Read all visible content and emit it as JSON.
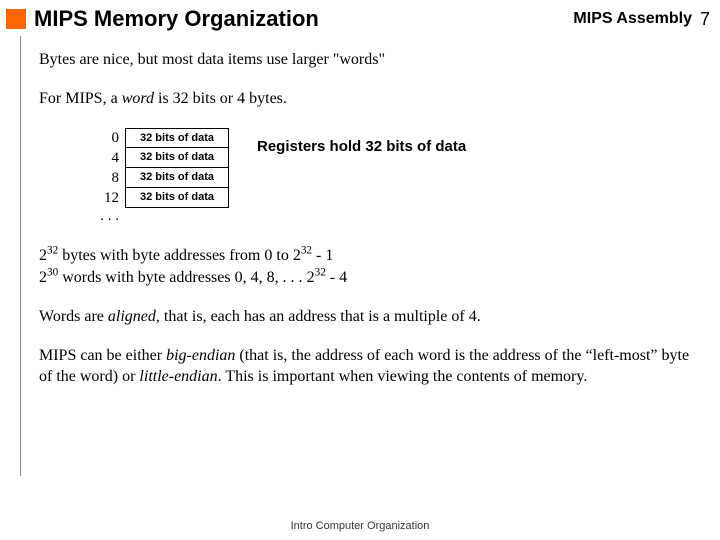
{
  "header": {
    "title": "MIPS Memory Organization",
    "topic": "MIPS Assembly",
    "page_number": "7"
  },
  "body": {
    "line1": "Bytes are nice, but most data items use larger \"words\"",
    "line2_pre": "For MIPS, a ",
    "line2_word": "word",
    "line2_post": " is 32 bits or 4 bytes."
  },
  "memory": {
    "rows": [
      {
        "addr": "0",
        "label": "32 bits of data"
      },
      {
        "addr": "4",
        "label": "32 bits of data"
      },
      {
        "addr": "8",
        "label": "32 bits of data"
      },
      {
        "addr": "12",
        "label": "32 bits of data"
      }
    ],
    "ellipsis": ". . .",
    "register_note": "Registers hold 32 bits of data"
  },
  "addr_space": {
    "l1a": "2",
    "l1b": "32",
    "l1c": " bytes with byte addresses from 0 to 2",
    "l1d": "32",
    "l1e": " - 1",
    "l2a": "2",
    "l2b": "30",
    "l2c": " words with byte addresses 0, 4, 8, . . . 2",
    "l2d": "32",
    "l2e": " - 4"
  },
  "aligned": {
    "pre": "Words are ",
    "word": "aligned",
    "post": ", that is, each has an address that is a multiple of 4."
  },
  "endian": {
    "a": "MIPS can be either ",
    "b": "big-endian",
    "c": " (that is, the address of each word is the address of the “left-most” byte of the word) or ",
    "d": "little-endian",
    "e": ".  This is important when viewing the contents of memory."
  },
  "footer": "Intro Computer Organization"
}
